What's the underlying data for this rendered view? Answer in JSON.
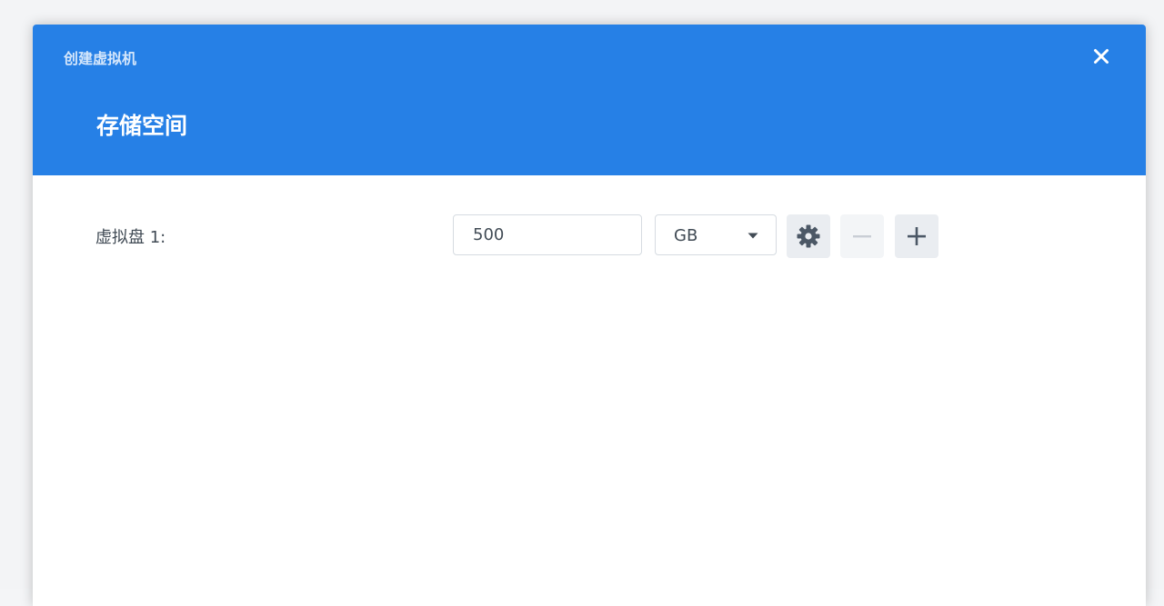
{
  "window": {
    "title": "创建虚拟机",
    "close_icon": "close-icon"
  },
  "header": {
    "step_title": "存储空间"
  },
  "colors": {
    "header_bg": "#2680e6",
    "body_bg": "#ffffff"
  },
  "disks": [
    {
      "label": "虚拟盘 1:",
      "size_value": "500",
      "unit_selected": "GB",
      "actions": {
        "settings_icon": "gear-icon",
        "remove_icon": "minus-icon",
        "remove_disabled": true,
        "add_icon": "plus-icon"
      }
    }
  ]
}
